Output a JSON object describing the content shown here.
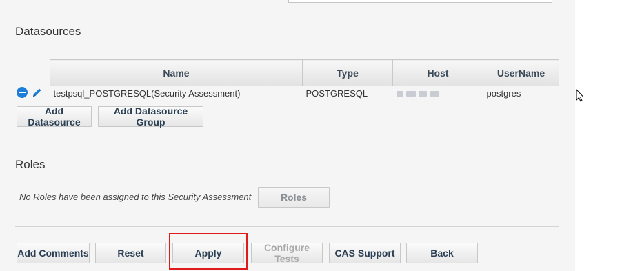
{
  "datasources": {
    "title": "Datasources",
    "columns": [
      "Name",
      "Type",
      "Host",
      "UserName"
    ],
    "rows": [
      {
        "name": "testpsql_POSTGRESQL(Security Assessment)",
        "type": "POSTGRESQL",
        "host": "",
        "username": "postgres"
      }
    ],
    "add_datasource_label": "Add Datasource",
    "add_group_label": "Add Datasource Group"
  },
  "roles": {
    "title": "Roles",
    "message": "No Roles have been assigned to this Security Assessment",
    "roles_button_label": "Roles"
  },
  "footer": {
    "add_comments_label": "Add Comments",
    "reset_label": "Reset",
    "apply_label": "Apply",
    "configure_tests_label": "Configure Tests",
    "cas_support_label": "CAS Support",
    "back_label": "Back"
  },
  "icons": {
    "remove": "minus-circle-icon",
    "edit": "pencil-icon",
    "cursor": "mouse-pointer-icon"
  },
  "colors": {
    "accent": "#1c7ed6",
    "highlight": "#e01b1b",
    "panel_bg": "#f5f5f5"
  }
}
